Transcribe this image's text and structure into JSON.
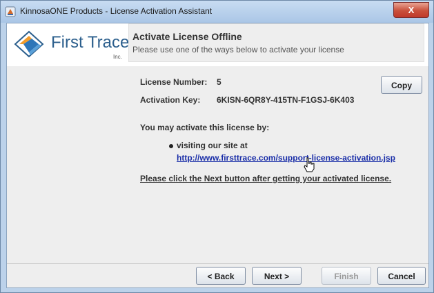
{
  "window": {
    "title": "KinnosaONE Products - License Activation Assistant",
    "close_label": "X"
  },
  "logo": {
    "brand": "First Trace",
    "inc": "Inc."
  },
  "header": {
    "title": "Activate License Offline",
    "subtitle": "Please use one of the ways below to activate your license"
  },
  "license": {
    "number_label": "License Number:",
    "number_value": "5",
    "key_label": "Activation Key:",
    "key_value": "6KISN-6QR8Y-415TN-F1GSJ-6K403",
    "copy_label": "Copy"
  },
  "instructions": {
    "intro": "You may activate this license by:",
    "bullet": "visiting our site at",
    "url": "http://www.firsttrace.com/support-license-activation.jsp",
    "note": "Please click the Next button after getting your activated license."
  },
  "buttons": {
    "back": "< Back",
    "next": "Next >",
    "finish": "Finish",
    "cancel": "Cancel"
  },
  "colors": {
    "link": "#1a2ea8",
    "panel": "#eeeeee",
    "logo_text": "#2c5f8d"
  },
  "icons": [
    "app-icon",
    "close-icon",
    "first-trace-logo-icon",
    "hand-cursor-icon"
  ]
}
